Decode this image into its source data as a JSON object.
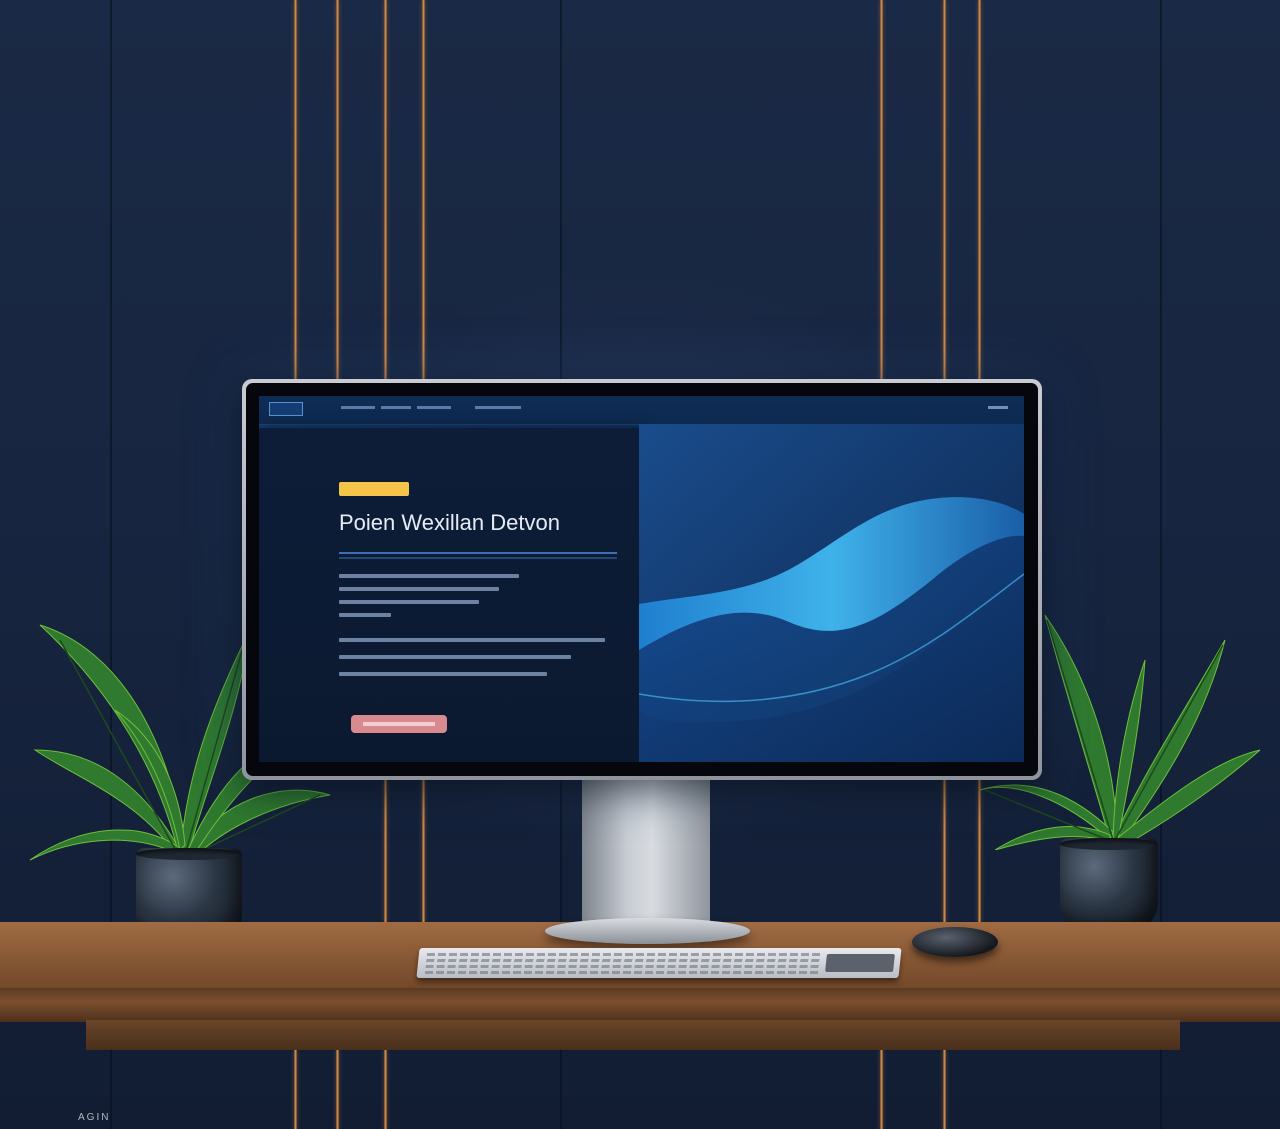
{
  "screen": {
    "hero_title": "Poien Wexillan Detvon",
    "badge_color": "#f5c54a",
    "accent_color": "#3f6fb3",
    "cta_color": "#d98a8f"
  },
  "watermark": {
    "text": "AGIN"
  }
}
